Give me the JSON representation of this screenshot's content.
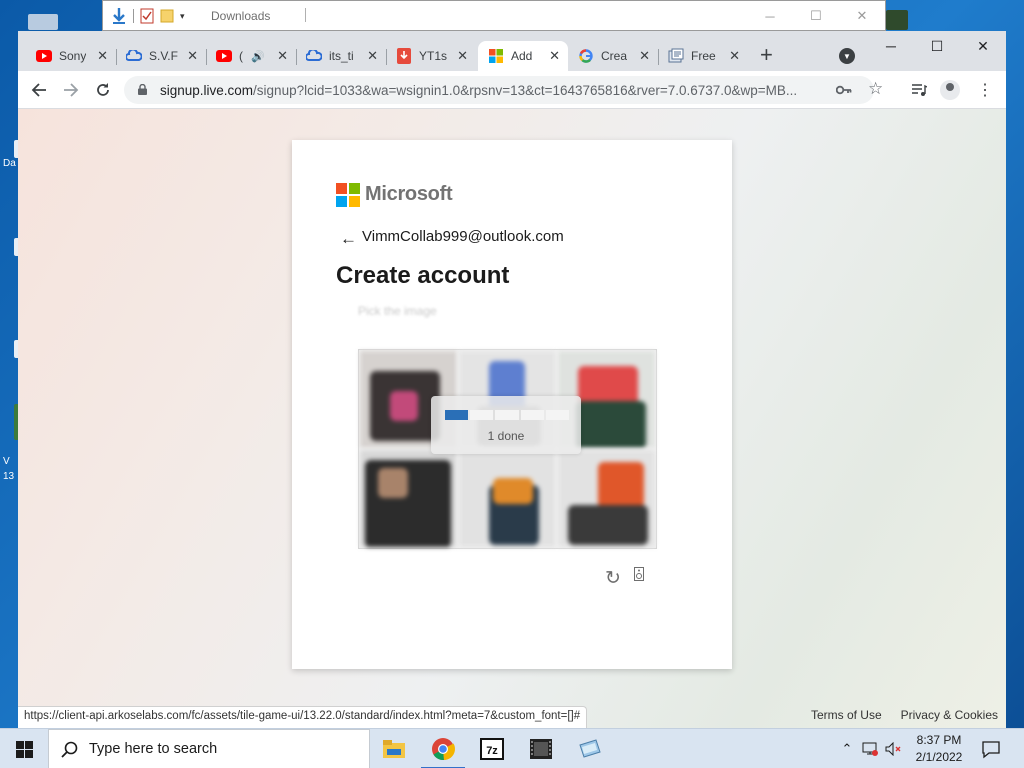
{
  "explorer": {
    "title": "Downloads"
  },
  "desktop": {
    "labels": [
      "Da",
      "V",
      "13"
    ]
  },
  "tabs": [
    {
      "label": "Sony",
      "icon": "youtube-icon"
    },
    {
      "label": "S.V.F",
      "icon": "cloud-icon"
    },
    {
      "label": "(",
      "icon": "youtube-icon",
      "audio": "🔊"
    },
    {
      "label": "its_ti",
      "icon": "cloud-icon"
    },
    {
      "label": "YT1s",
      "icon": "download-icon"
    },
    {
      "label": "Add",
      "icon": "microsoft-icon",
      "active": true
    },
    {
      "label": "Crea",
      "icon": "google-icon"
    },
    {
      "label": "Free",
      "icon": "document-icon"
    }
  ],
  "tab_close_glyph": "✕",
  "new_tab_glyph": "+",
  "address": {
    "host": "signup.live.com",
    "path": "/signup?lcid=1033&wa=wsignin1.0&rpsnv=13&ct=1643765816&rver=7.0.6737.0&wp=MB..."
  },
  "page": {
    "brand": "Microsoft",
    "back_glyph": "←",
    "identity": "VimmCollab999@outlook.com",
    "heading": "Create account",
    "instruction": "Pick the image",
    "puzzle": {
      "loader_text": "1 done",
      "progress_segments": 5,
      "progress_done": 1
    },
    "refresh_glyph": "↻",
    "audio_glyph": "▯",
    "footer": {
      "terms": "Terms of Use",
      "privacy": "Privacy & Cookies"
    }
  },
  "status_bar": {
    "url": "https://client-api.arkoselabs.com/fc/assets/tile-game-ui/13.22.0/standard/index.html?meta=7&custom_font=[]#"
  },
  "taskbar": {
    "search_placeholder": "Type here to search",
    "apps": [
      "file-explorer",
      "chrome",
      "7-zip",
      "video-editor",
      "folder-app"
    ],
    "time": "8:37 PM",
    "date": "2/1/2022"
  },
  "colors": {
    "accent": "#2a6fb7",
    "youtube": "#ff0000",
    "ms_red": "#f25022",
    "ms_green": "#7fba00",
    "ms_blue": "#00a4ef",
    "ms_yellow": "#ffb900"
  }
}
